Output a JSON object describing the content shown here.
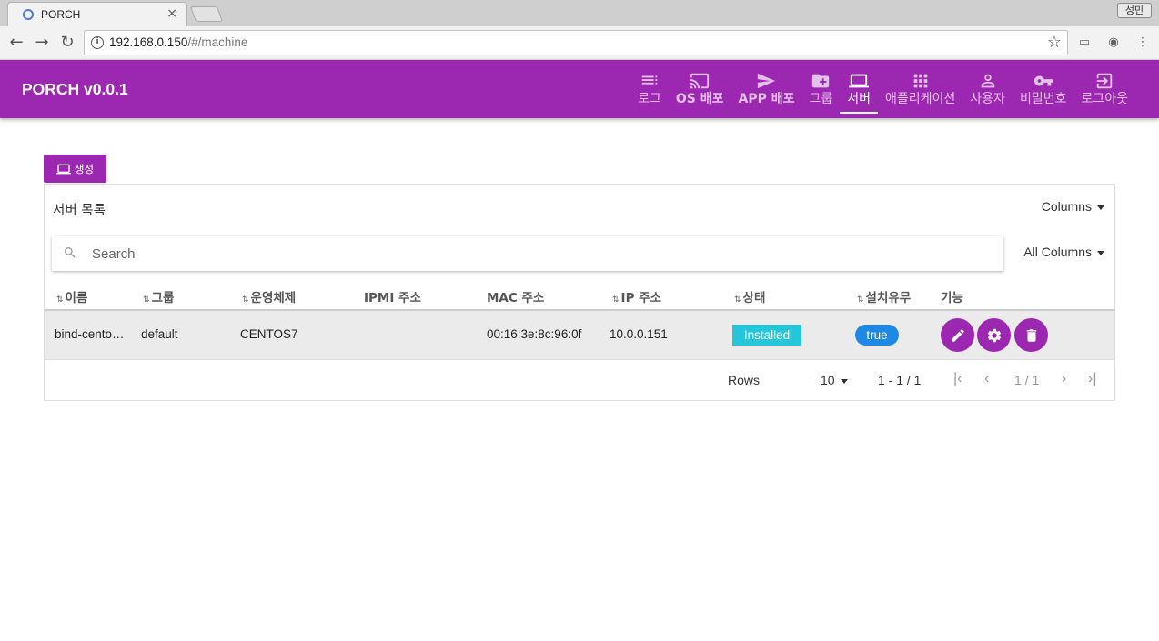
{
  "browser": {
    "tab_title": "PORCH",
    "tab_close": "×",
    "profile": "성민",
    "url_host": "192.168.0.150",
    "url_path": "/#/machine"
  },
  "app": {
    "brand": "PORCH v0.0.1",
    "menu": [
      {
        "label": "로그",
        "icon": "list-icon"
      },
      {
        "label": "OS 배포",
        "icon": "cast-icon"
      },
      {
        "label": "APP 배포",
        "icon": "send-icon"
      },
      {
        "label": "그룹",
        "icon": "folder-add-icon"
      },
      {
        "label": "서버",
        "icon": "laptop-icon",
        "active": true
      },
      {
        "label": "애플리케이션",
        "icon": "apps-grid-icon"
      },
      {
        "label": "사용자",
        "icon": "person-icon"
      },
      {
        "label": "비밀번호",
        "icon": "key-icon"
      },
      {
        "label": "로그아웃",
        "icon": "exit-icon"
      }
    ]
  },
  "content": {
    "create_label": "생성",
    "panel_title": "서버 목록",
    "columns_label": "Columns",
    "all_columns_label": "All Columns",
    "search_placeholder": "Search",
    "headers": [
      "이름",
      "그룹",
      "운영체제",
      "IPMI 주소",
      "MAC 주소",
      "IP 주소",
      "상태",
      "설치유무",
      "기능"
    ],
    "rows": [
      {
        "name": "bind-cento…",
        "group": "default",
        "os": "CENTOS7",
        "ipmi": "",
        "mac": "00:16:3e:8c:96:0f",
        "ip": "10.0.0.151",
        "status": "Installed",
        "installed": "true"
      }
    ],
    "pager": {
      "rows_label": "Rows",
      "rows_per_page": "10",
      "range": "1 - 1 / 1",
      "page": "1 / 1"
    }
  },
  "colors": {
    "primary": "#9c27b0",
    "installed_badge": "#26c6da",
    "true_badge": "#1e88e5"
  }
}
